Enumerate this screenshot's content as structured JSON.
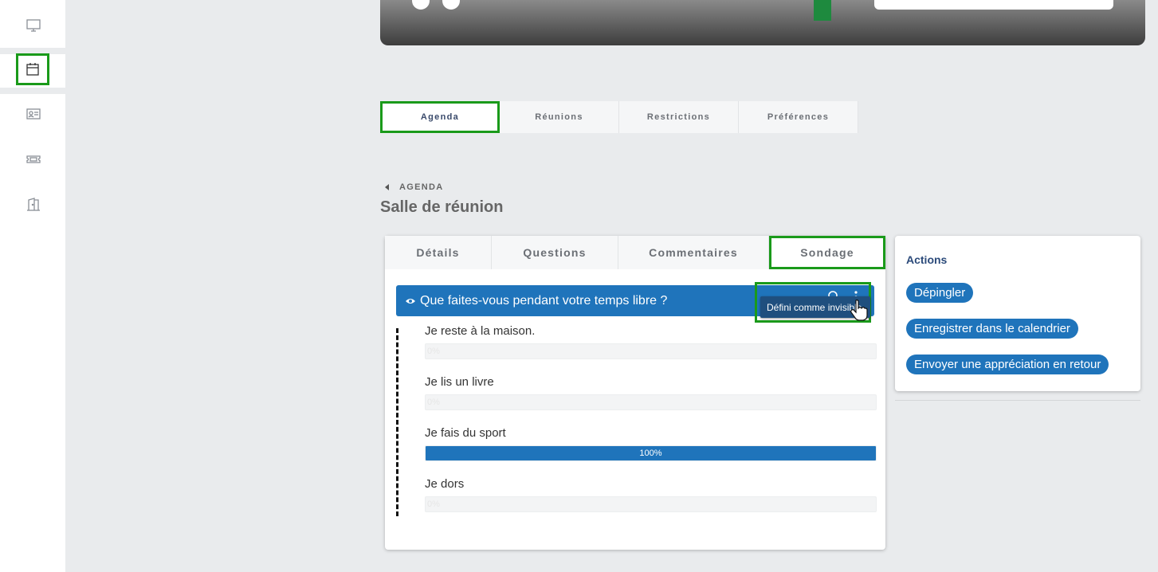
{
  "sidebar": {
    "items": [
      {
        "name": "monitor"
      },
      {
        "name": "calendar"
      },
      {
        "name": "contact-card"
      },
      {
        "name": "ticket"
      },
      {
        "name": "exit-door"
      }
    ]
  },
  "top_tabs": [
    {
      "label": "Agenda",
      "active": true
    },
    {
      "label": "Réunions",
      "active": false
    },
    {
      "label": "Restrictions",
      "active": false
    },
    {
      "label": "Préférences",
      "active": false
    }
  ],
  "breadcrumb": {
    "label": "AGENDA"
  },
  "page_title": "Salle de réunion",
  "card_tabs": [
    {
      "label": "Détails",
      "active": false
    },
    {
      "label": "Questions",
      "active": false
    },
    {
      "label": "Commentaires",
      "active": false
    },
    {
      "label": "Sondage",
      "active": true
    }
  ],
  "poll": {
    "question": "Que faites-vous pendant votre temps libre ?",
    "tooltip": "Défini comme invisible",
    "options": [
      {
        "label": "Je reste à la maison.",
        "percent_text": "0%",
        "percent": 0
      },
      {
        "label": "Je lis un livre",
        "percent_text": "0%",
        "percent": 0
      },
      {
        "label": "Je fais du sport",
        "percent_text": "100%",
        "percent": 100
      },
      {
        "label": "Je dors",
        "percent_text": "0%",
        "percent": 0
      }
    ]
  },
  "actions": {
    "title": "Actions",
    "buttons": [
      {
        "label": "Dépingler"
      },
      {
        "label": "Enregistrer dans le calendrier"
      },
      {
        "label": "Envoyer une appréciation en retour"
      }
    ]
  },
  "colors": {
    "accent": "#1f74bb",
    "highlight": "#1a9a1a",
    "background": "#e9ebed"
  }
}
